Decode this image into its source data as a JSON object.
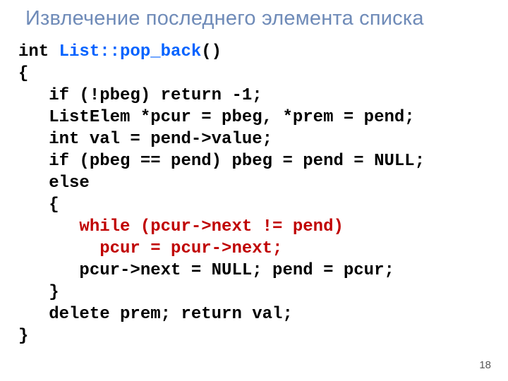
{
  "title": "Извлечение последнего элемента списка",
  "page_number": "18",
  "code": {
    "l1_a": "int ",
    "l1_b": "List::pop_back",
    "l1_c": "()",
    "l2": "{",
    "l3": "   if (!pbeg) return -1;",
    "l4": "   ListElem *pcur = pbeg, *prem = pend;",
    "l5": "   int val = pend->value;",
    "l6": "   if (pbeg == pend) pbeg = pend = NULL;",
    "l7": "   else",
    "l8": "   {",
    "l9": "      while (pcur->next != pend)",
    "l10": "        pcur = pcur->next;",
    "l11": "      pcur->next = NULL; pend = pcur;",
    "l12": "   }",
    "l13": "   delete prem; return val;",
    "l14": "}"
  }
}
